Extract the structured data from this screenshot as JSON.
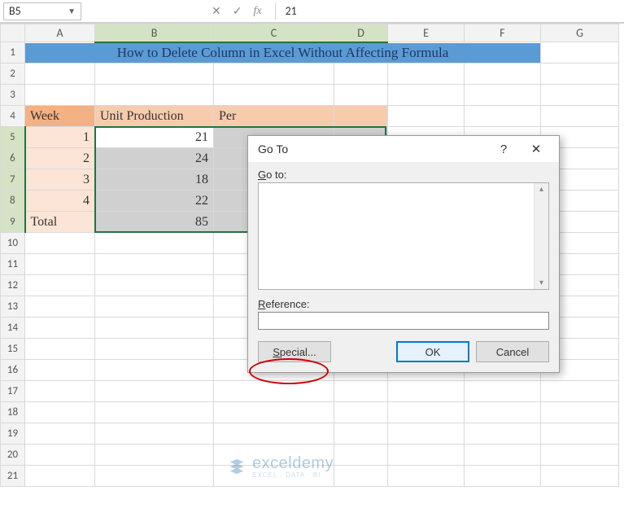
{
  "namebox": "B5",
  "fbar": {
    "cancel": "✕",
    "accept": "✓",
    "fx": "fx",
    "value": "21"
  },
  "cols": [
    "A",
    "B",
    "C",
    "D",
    "E",
    "F",
    "G"
  ],
  "rows": [
    "1",
    "2",
    "3",
    "4",
    "5",
    "6",
    "7",
    "8",
    "9",
    "10",
    "11",
    "12",
    "13",
    "14",
    "15",
    "16",
    "17",
    "18",
    "19",
    "20",
    "21"
  ],
  "title": "How to Delete Column in Excel Without Affecting Formula",
  "headers": {
    "week": "Week",
    "unit": "Unit Production",
    "per": "Per"
  },
  "data": {
    "weeks": [
      "1",
      "2",
      "3",
      "4"
    ],
    "units": [
      "21",
      "24",
      "18",
      "22"
    ],
    "total_label": "Total",
    "total_value": "85"
  },
  "dialog": {
    "title": "Go To",
    "help": "?",
    "close": "✕",
    "goto_label": "Go to:",
    "ref_label_u": "R",
    "ref_label_rest": "eference:",
    "special_u": "S",
    "special_rest": "pecial...",
    "ok": "OK",
    "cancel": "Cancel",
    "scroll_up": "▴",
    "scroll_down": "▾"
  },
  "watermark": {
    "brand": "exceldemy",
    "sub": "EXCEL · DATA · BI"
  }
}
